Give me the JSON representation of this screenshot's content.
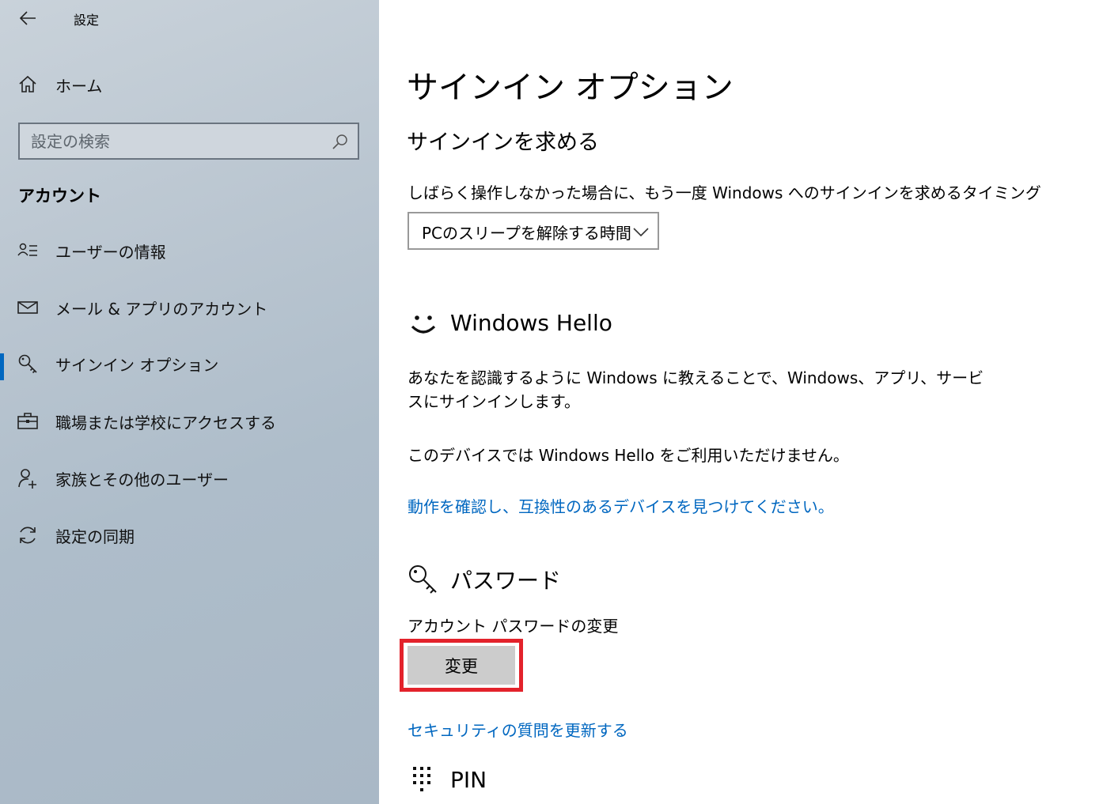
{
  "window": {
    "title": "設定"
  },
  "sidebar": {
    "home_label": "ホーム",
    "search_placeholder": "設定の検索",
    "section_heading": "アカウント",
    "items": [
      {
        "label": "ユーザーの情報",
        "icon": "user-info-icon"
      },
      {
        "label": "メール & アプリのアカウント",
        "icon": "mail-icon"
      },
      {
        "label": "サインイン オプション",
        "icon": "key-icon",
        "selected": true
      },
      {
        "label": "職場または学校にアクセスする",
        "icon": "briefcase-icon"
      },
      {
        "label": "家族とその他のユーザー",
        "icon": "add-user-icon"
      },
      {
        "label": "設定の同期",
        "icon": "sync-icon"
      }
    ]
  },
  "main": {
    "page_title": "サインイン オプション",
    "require_signin": {
      "heading": "サインインを求める",
      "description": "しばらく操作しなかった場合に、もう一度 Windows へのサインインを求めるタイミング",
      "dropdown_value": "PCのスリープを解除する時間"
    },
    "windows_hello": {
      "heading": "Windows Hello",
      "description_line1": "あなたを認識するように Windows に教えることで、Windows、アプリ、サービ",
      "description_line2": "スにサインインします。",
      "unavailable": "このデバイスでは Windows Hello をご利用いただけません。",
      "link": "動作を確認し、互換性のあるデバイスを見つけてください。"
    },
    "password": {
      "heading": "パスワード",
      "description": "アカウント パスワードの変更",
      "button": "変更",
      "link": "セキュリティの質問を更新する"
    },
    "pin": {
      "heading": "PIN"
    }
  },
  "colors": {
    "accent": "#0067c0",
    "highlight": "#e3222b",
    "sidebar_bg": "#b9c5d0"
  }
}
